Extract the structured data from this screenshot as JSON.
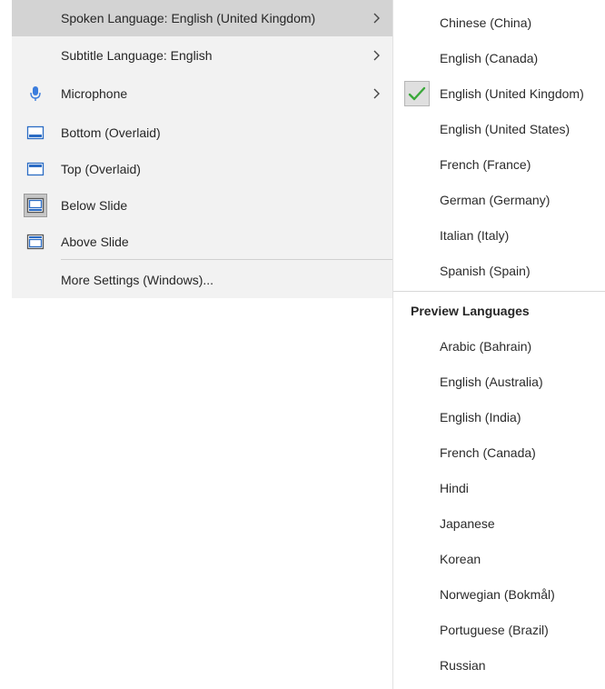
{
  "menu": {
    "items": [
      {
        "label": "Spoken Language: English (United Kingdom)",
        "has_submenu": true,
        "active": true
      },
      {
        "label": "Subtitle Language: English",
        "has_submenu": true
      },
      {
        "label": "Microphone",
        "has_submenu": true,
        "icon": "microphone-icon"
      },
      {
        "label": "Bottom (Overlaid)",
        "icon": "subtitle-bottom-overlaid-icon"
      },
      {
        "label": "Top (Overlaid)",
        "icon": "subtitle-top-overlaid-icon"
      },
      {
        "label": "Below Slide",
        "icon": "subtitle-below-slide-icon",
        "selected": true
      },
      {
        "label": "Above Slide",
        "icon": "subtitle-above-slide-icon"
      },
      {
        "label": "More Settings (Windows)..."
      }
    ]
  },
  "submenu": {
    "languages": [
      {
        "label": "Chinese (China)"
      },
      {
        "label": "English (Canada)"
      },
      {
        "label": "English (United Kingdom)",
        "checked": true
      },
      {
        "label": "English (United States)"
      },
      {
        "label": "French (France)"
      },
      {
        "label": "German (Germany)"
      },
      {
        "label": "Italian (Italy)"
      },
      {
        "label": "Spanish (Spain)"
      }
    ],
    "preview_header": "Preview Languages",
    "preview_languages": [
      {
        "label": "Arabic (Bahrain)"
      },
      {
        "label": "English (Australia)"
      },
      {
        "label": "English (India)"
      },
      {
        "label": "French (Canada)"
      },
      {
        "label": "Hindi"
      },
      {
        "label": "Japanese"
      },
      {
        "label": "Korean"
      },
      {
        "label": "Norwegian (Bokmål)"
      },
      {
        "label": "Portuguese (Brazil)"
      },
      {
        "label": "Russian"
      }
    ]
  },
  "colors": {
    "menu_bg": "#f2f2f2",
    "active_bg": "#d3d3d3",
    "check_green": "#3aa83a",
    "mic_blue": "#3b7ddd",
    "icon_blue": "#2b6cc4"
  }
}
